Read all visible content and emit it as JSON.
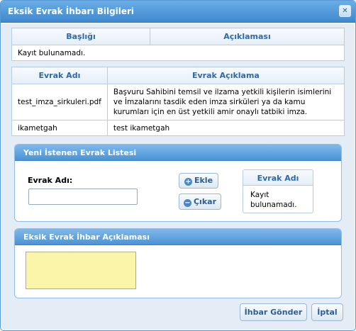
{
  "window": {
    "title": "Eksik Evrak İhbarı Bilgileri",
    "close_glyph": "✕"
  },
  "notices": {
    "headers": [
      "Başlığı",
      "Açıklaması"
    ],
    "empty_text": "Kayıt bulunamadı."
  },
  "documents": {
    "headers": [
      "Evrak Adı",
      "Evrak Açıklama"
    ],
    "rows": [
      {
        "name": "test_imza_sirkuleri.pdf",
        "desc": "Başvuru Sahibini temsil ve ilzama yetkili kişilerin isimlerini ve İmzalarını tasdik eden imza sirküleri ya da kamu kurumları için en üst yetkili amir onaylı tatbiki imza."
      },
      {
        "name": "ikametgah",
        "desc": "test ikametgah"
      }
    ]
  },
  "new_docs": {
    "title": "Yeni İstenen Evrak Listesi",
    "field_label": "Evrak Adı:",
    "field_value": "",
    "add_label": "Ekle",
    "add_glyph": "+",
    "remove_label": "Çıkar",
    "remove_glyph": "−",
    "list_header": "Evrak Adı",
    "list_empty": "Kayıt bulunamadı."
  },
  "notice_text": {
    "title": "Eksik Evrak İhbar Açıklaması",
    "value": ""
  },
  "footer": {
    "submit_label": "İhbar Gönder",
    "cancel_label": "İptal"
  }
}
